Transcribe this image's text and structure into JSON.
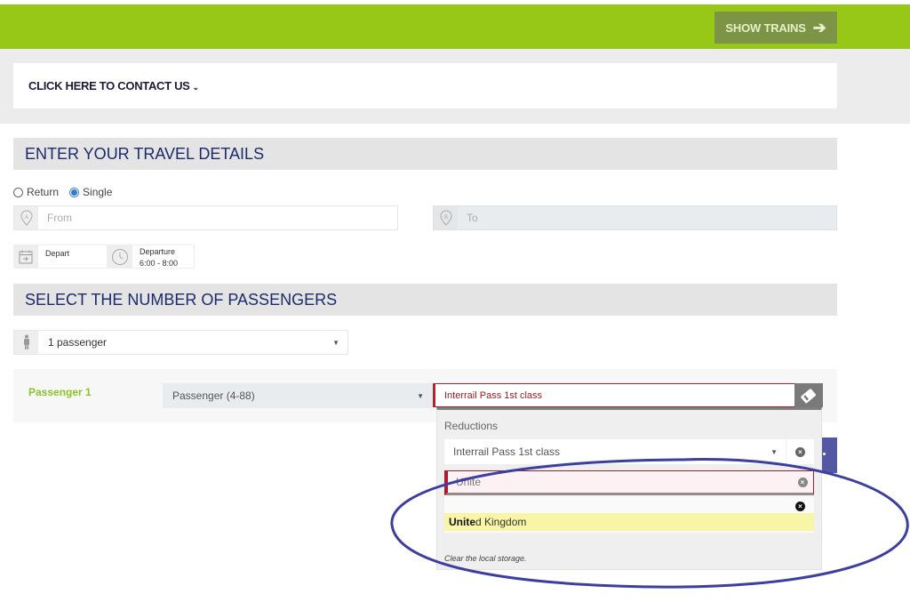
{
  "header": {
    "show_trains_label": "SHOW TRAINS",
    "show_trains_icon": "arrow-right-icon",
    "accent_color": "#97c817"
  },
  "contact": {
    "label": "CLICK HERE TO CONTACT US",
    "chevron": "»"
  },
  "travel": {
    "section_title": "ENTER YOUR TRAVEL DETAILS",
    "trip_types": [
      {
        "label": "Return",
        "checked": false
      },
      {
        "label": "Single",
        "checked": true
      }
    ],
    "from_placeholder": "From",
    "to_placeholder": "To",
    "from_marker": "A",
    "to_marker": "B",
    "depart_label": "Depart",
    "departure_label": "Departure",
    "departure_time": "6:00 - 8:00"
  },
  "passengers": {
    "section_title": "SELECT THE NUMBER OF PASSENGERS",
    "count_value": "1 passenger",
    "rows": [
      {
        "label": "Passenger 1",
        "type_value": "Passenger (4-88)",
        "reduction_value": "Interrail Pass 1st class"
      }
    ]
  },
  "reductions_dropdown": {
    "label": "Reductions",
    "selected": "Interrail Pass 1st class",
    "country_input_value": "Unite",
    "suggestions": [
      {
        "match": "Unite",
        "rest": "d Kingdom"
      }
    ],
    "clear_storage_label": "Clear the local storage."
  }
}
